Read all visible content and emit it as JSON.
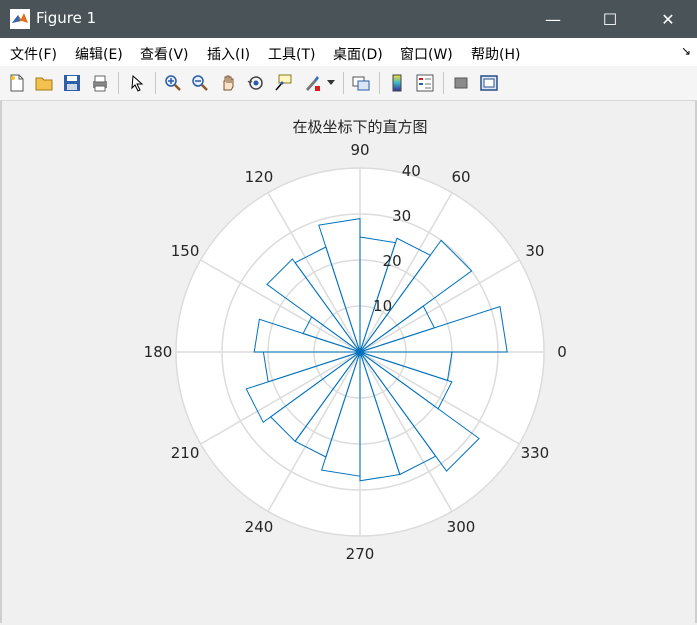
{
  "window": {
    "title": "Figure 1",
    "minimize_glyph": "—",
    "maximize_glyph": "☐",
    "close_glyph": "✕"
  },
  "menu": {
    "items": [
      "文件(F)",
      "编辑(E)",
      "查看(V)",
      "插入(I)",
      "工具(T)",
      "桌面(D)",
      "窗口(W)",
      "帮助(H)"
    ],
    "corner_glyph": "↘"
  },
  "toolbar": {
    "icons": [
      "new-figure-icon",
      "open-file-icon",
      "save-icon",
      "print-icon",
      "pointer-icon",
      "zoom-in-icon",
      "zoom-out-icon",
      "pan-hand-icon",
      "rotate-3d-icon",
      "data-cursor-icon",
      "brush-icon",
      "brush-dropdown-icon",
      "link-plot-icon",
      "colorbar-icon",
      "legend-icon",
      "hide-plot-tools-icon",
      "show-plot-tools-icon"
    ]
  },
  "colors": {
    "histogram": "#0072BD",
    "grid": "#dcdcdc",
    "axes_bg": "#ffffff",
    "titlebar": "#4a5358"
  },
  "chart_data": {
    "type": "polar-histogram",
    "title": "在极坐标下的直方图",
    "r_max": 40,
    "r_ticks": [
      10,
      20,
      30,
      40
    ],
    "theta_ticks": [
      0,
      30,
      60,
      90,
      120,
      150,
      180,
      210,
      240,
      270,
      300,
      330
    ],
    "grid": true,
    "bin_width_deg": 18,
    "bins": [
      {
        "start": 0,
        "end": 18,
        "count": 32
      },
      {
        "start": 18,
        "end": 36,
        "count": 17
      },
      {
        "start": 36,
        "end": 54,
        "count": 30
      },
      {
        "start": 54,
        "end": 72,
        "count": 26
      },
      {
        "start": 72,
        "end": 90,
        "count": 25
      },
      {
        "start": 90,
        "end": 108,
        "count": 29
      },
      {
        "start": 108,
        "end": 126,
        "count": 24
      },
      {
        "start": 126,
        "end": 144,
        "count": 25
      },
      {
        "start": 144,
        "end": 162,
        "count": 13
      },
      {
        "start": 162,
        "end": 180,
        "count": 23
      },
      {
        "start": 180,
        "end": 198,
        "count": 21
      },
      {
        "start": 198,
        "end": 216,
        "count": 26
      },
      {
        "start": 216,
        "end": 234,
        "count": 24
      },
      {
        "start": 234,
        "end": 252,
        "count": 24
      },
      {
        "start": 252,
        "end": 270,
        "count": 27
      },
      {
        "start": 270,
        "end": 288,
        "count": 28
      },
      {
        "start": 288,
        "end": 306,
        "count": 28
      },
      {
        "start": 306,
        "end": 324,
        "count": 32
      },
      {
        "start": 324,
        "end": 342,
        "count": 21
      },
      {
        "start": 342,
        "end": 360,
        "count": 20
      }
    ]
  }
}
